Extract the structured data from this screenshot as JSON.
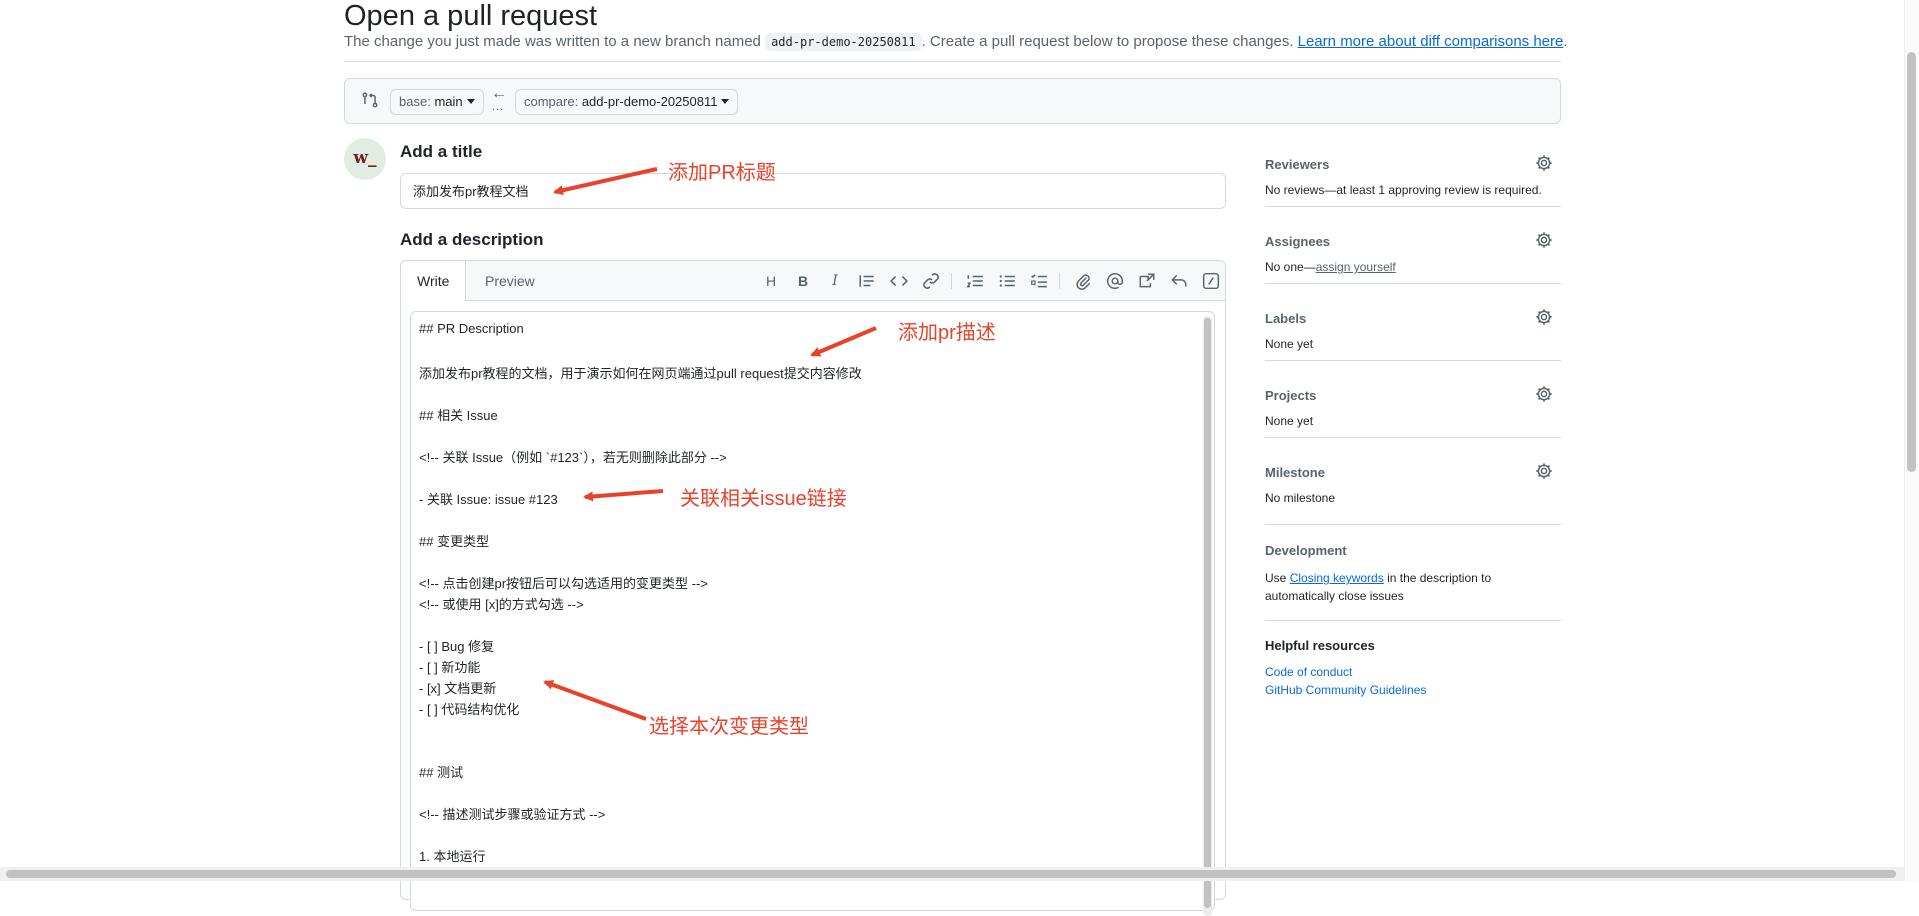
{
  "page": {
    "title": "Open a pull request",
    "subtitle_before": "The change you just made was written to a new branch named ",
    "branch_name": "add-pr-demo-20250811",
    "subtitle_after": ". Create a pull request below to propose these changes. ",
    "learn_more": "Learn more about diff comparisons here",
    "learn_more_end": "."
  },
  "compare": {
    "base_label": "base:",
    "base_value": "main",
    "compare_label": "compare:",
    "compare_value": "add-pr-demo-20250811",
    "dots": "..."
  },
  "avatar": {
    "initials": "w_"
  },
  "form": {
    "title_label": "Add a title",
    "title_value": "添加发布pr教程文档",
    "description_label": "Add a description",
    "tabs": [
      "Write",
      "Preview"
    ],
    "body_lines": [
      "## PR Description",
      "",
      "添加发布pr教程的文档，用于演示如何在网页端通过pull request提交内容修改",
      "",
      "## 相关 Issue",
      "",
      "<!-- 关联 Issue（例如 `#123`），若无则删除此部分 -->",
      "",
      "- 关联 Issue: issue #123",
      "",
      "## 变更类型",
      "",
      "<!-- 点击创建pr按钮后可以勾选适用的变更类型 -->",
      "<!-- 或使用 [x]的方式勾选 -->",
      "",
      "- [ ] Bug 修复",
      "- [ ] 新功能",
      "- [x] 文档更新",
      "- [ ] 代码结构优化",
      "",
      "",
      "## 测试",
      "",
      "<!-- 描述测试步骤或验证方式 -->",
      "",
      "1. 本地运行"
    ]
  },
  "toolbar": {
    "heading": "H",
    "bold": "B",
    "italic": "I"
  },
  "sidebar": {
    "reviewers": {
      "title": "Reviewers",
      "text": "No reviews—at least 1 approving review is required."
    },
    "assignees": {
      "title": "Assignees",
      "text": "No one—",
      "link": "assign yourself"
    },
    "labels": {
      "title": "Labels",
      "text": "None yet"
    },
    "projects": {
      "title": "Projects",
      "text": "None yet"
    },
    "milestone": {
      "title": "Milestone",
      "text": "No milestone"
    },
    "development": {
      "title": "Development",
      "text_before": "Use ",
      "link": "Closing keywords",
      "text_after": " in the description to automatically close issues"
    },
    "helpful": {
      "title": "Helpful resources",
      "links": [
        "Code of conduct",
        "GitHub Community Guidelines"
      ]
    }
  },
  "annotations": {
    "title": "添加PR标题",
    "description": "添加pr描述",
    "issue": "关联相关issue链接",
    "type": "选择本次变更类型"
  },
  "colors": {
    "accent_link": "#0969da",
    "annotation": "#e8432a",
    "muted": "#59636e"
  }
}
